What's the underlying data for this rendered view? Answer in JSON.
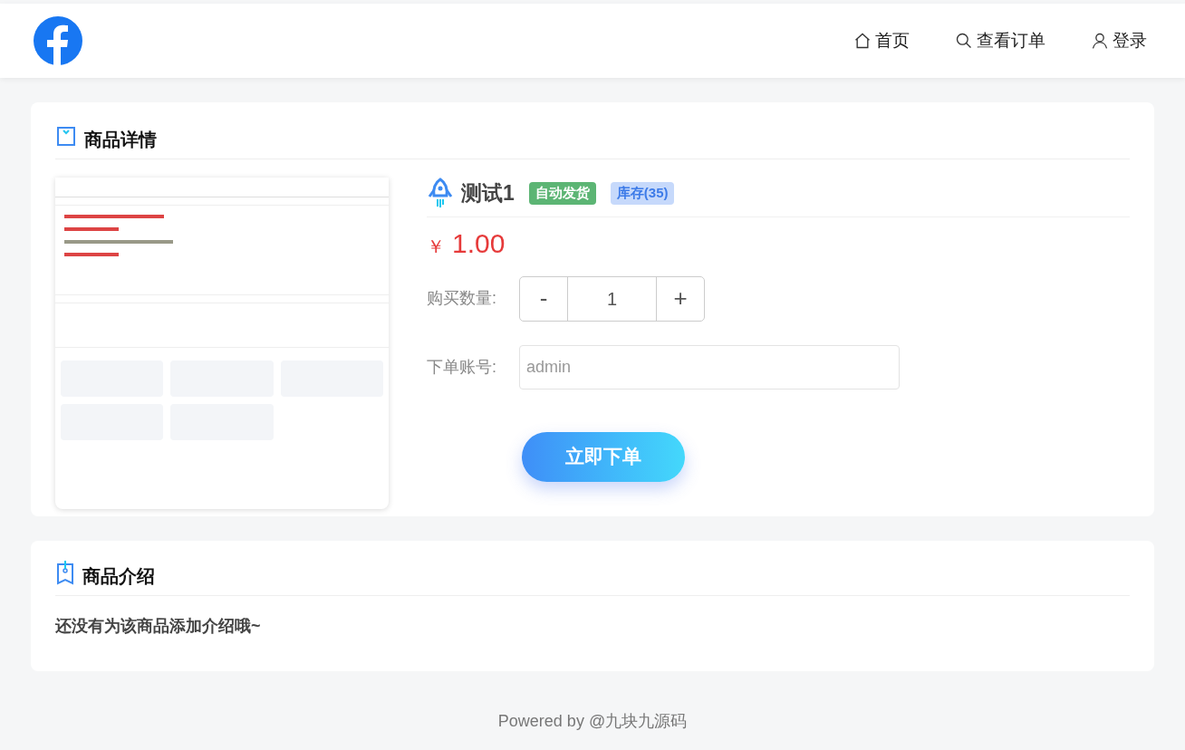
{
  "nav": {
    "items": [
      {
        "kind": "home",
        "label": "首页"
      },
      {
        "kind": "search",
        "label": "查看订单"
      },
      {
        "kind": "user",
        "label": "登录"
      }
    ]
  },
  "detail": {
    "title": "商品详情",
    "product": {
      "name": "测试1",
      "badges": [
        {
          "label": "自动发货",
          "color": "#5cb574"
        },
        {
          "label": "库存(35)",
          "color": "#c6d9fb"
        }
      ],
      "currency": "￥",
      "price": "1.00"
    },
    "quantity": {
      "label": "购买数量:",
      "minus": "-",
      "value": "1",
      "plus": "+"
    },
    "account": {
      "label": "下单账号:",
      "value": "admin"
    },
    "submit": "立即下单"
  },
  "intro": {
    "title": "商品介绍",
    "text": "还没有为该商品添加介绍哦~"
  },
  "footer": "Powered by @九块九源码"
}
